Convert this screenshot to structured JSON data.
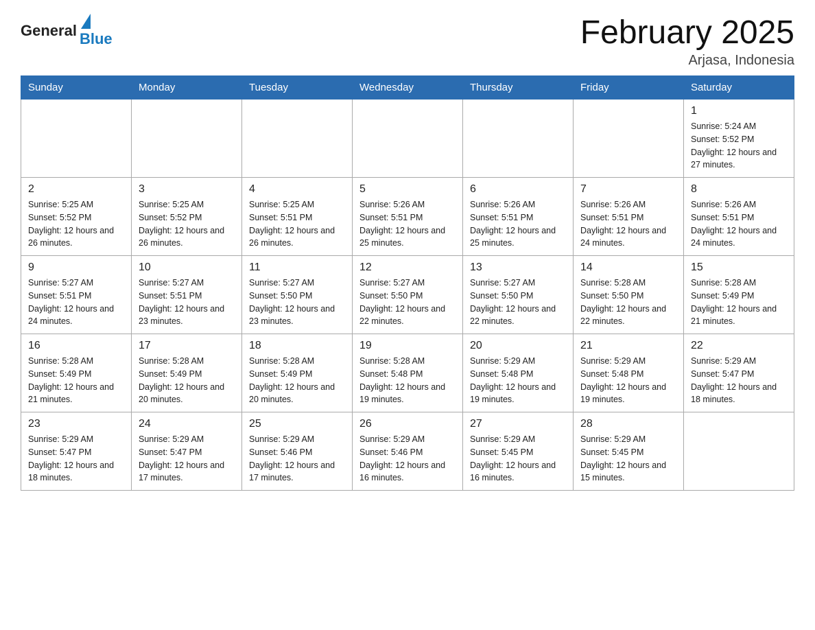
{
  "header": {
    "logo_general": "General",
    "logo_blue": "Blue",
    "month_title": "February 2025",
    "location": "Arjasa, Indonesia"
  },
  "days_of_week": [
    "Sunday",
    "Monday",
    "Tuesday",
    "Wednesday",
    "Thursday",
    "Friday",
    "Saturday"
  ],
  "weeks": [
    [
      {
        "day": "",
        "info": ""
      },
      {
        "day": "",
        "info": ""
      },
      {
        "day": "",
        "info": ""
      },
      {
        "day": "",
        "info": ""
      },
      {
        "day": "",
        "info": ""
      },
      {
        "day": "",
        "info": ""
      },
      {
        "day": "1",
        "info": "Sunrise: 5:24 AM\nSunset: 5:52 PM\nDaylight: 12 hours and 27 minutes."
      }
    ],
    [
      {
        "day": "2",
        "info": "Sunrise: 5:25 AM\nSunset: 5:52 PM\nDaylight: 12 hours and 26 minutes."
      },
      {
        "day": "3",
        "info": "Sunrise: 5:25 AM\nSunset: 5:52 PM\nDaylight: 12 hours and 26 minutes."
      },
      {
        "day": "4",
        "info": "Sunrise: 5:25 AM\nSunset: 5:51 PM\nDaylight: 12 hours and 26 minutes."
      },
      {
        "day": "5",
        "info": "Sunrise: 5:26 AM\nSunset: 5:51 PM\nDaylight: 12 hours and 25 minutes."
      },
      {
        "day": "6",
        "info": "Sunrise: 5:26 AM\nSunset: 5:51 PM\nDaylight: 12 hours and 25 minutes."
      },
      {
        "day": "7",
        "info": "Sunrise: 5:26 AM\nSunset: 5:51 PM\nDaylight: 12 hours and 24 minutes."
      },
      {
        "day": "8",
        "info": "Sunrise: 5:26 AM\nSunset: 5:51 PM\nDaylight: 12 hours and 24 minutes."
      }
    ],
    [
      {
        "day": "9",
        "info": "Sunrise: 5:27 AM\nSunset: 5:51 PM\nDaylight: 12 hours and 24 minutes."
      },
      {
        "day": "10",
        "info": "Sunrise: 5:27 AM\nSunset: 5:51 PM\nDaylight: 12 hours and 23 minutes."
      },
      {
        "day": "11",
        "info": "Sunrise: 5:27 AM\nSunset: 5:50 PM\nDaylight: 12 hours and 23 minutes."
      },
      {
        "day": "12",
        "info": "Sunrise: 5:27 AM\nSunset: 5:50 PM\nDaylight: 12 hours and 22 minutes."
      },
      {
        "day": "13",
        "info": "Sunrise: 5:27 AM\nSunset: 5:50 PM\nDaylight: 12 hours and 22 minutes."
      },
      {
        "day": "14",
        "info": "Sunrise: 5:28 AM\nSunset: 5:50 PM\nDaylight: 12 hours and 22 minutes."
      },
      {
        "day": "15",
        "info": "Sunrise: 5:28 AM\nSunset: 5:49 PM\nDaylight: 12 hours and 21 minutes."
      }
    ],
    [
      {
        "day": "16",
        "info": "Sunrise: 5:28 AM\nSunset: 5:49 PM\nDaylight: 12 hours and 21 minutes."
      },
      {
        "day": "17",
        "info": "Sunrise: 5:28 AM\nSunset: 5:49 PM\nDaylight: 12 hours and 20 minutes."
      },
      {
        "day": "18",
        "info": "Sunrise: 5:28 AM\nSunset: 5:49 PM\nDaylight: 12 hours and 20 minutes."
      },
      {
        "day": "19",
        "info": "Sunrise: 5:28 AM\nSunset: 5:48 PM\nDaylight: 12 hours and 19 minutes."
      },
      {
        "day": "20",
        "info": "Sunrise: 5:29 AM\nSunset: 5:48 PM\nDaylight: 12 hours and 19 minutes."
      },
      {
        "day": "21",
        "info": "Sunrise: 5:29 AM\nSunset: 5:48 PM\nDaylight: 12 hours and 19 minutes."
      },
      {
        "day": "22",
        "info": "Sunrise: 5:29 AM\nSunset: 5:47 PM\nDaylight: 12 hours and 18 minutes."
      }
    ],
    [
      {
        "day": "23",
        "info": "Sunrise: 5:29 AM\nSunset: 5:47 PM\nDaylight: 12 hours and 18 minutes."
      },
      {
        "day": "24",
        "info": "Sunrise: 5:29 AM\nSunset: 5:47 PM\nDaylight: 12 hours and 17 minutes."
      },
      {
        "day": "25",
        "info": "Sunrise: 5:29 AM\nSunset: 5:46 PM\nDaylight: 12 hours and 17 minutes."
      },
      {
        "day": "26",
        "info": "Sunrise: 5:29 AM\nSunset: 5:46 PM\nDaylight: 12 hours and 16 minutes."
      },
      {
        "day": "27",
        "info": "Sunrise: 5:29 AM\nSunset: 5:45 PM\nDaylight: 12 hours and 16 minutes."
      },
      {
        "day": "28",
        "info": "Sunrise: 5:29 AM\nSunset: 5:45 PM\nDaylight: 12 hours and 15 minutes."
      },
      {
        "day": "",
        "info": ""
      }
    ]
  ]
}
